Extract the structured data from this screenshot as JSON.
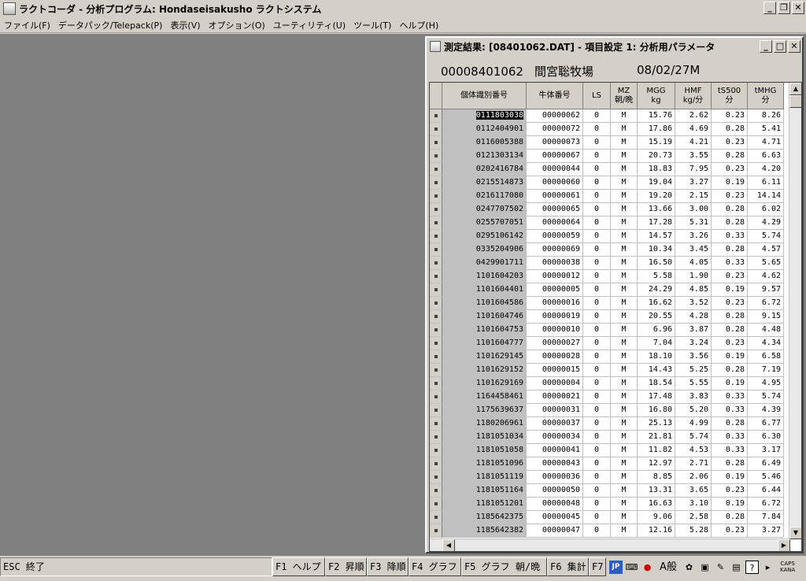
{
  "window": {
    "title": "ラクトコーダ - 分析プログラム: Hondaseisakusho ラクトシステム",
    "min": "_",
    "max": "❐",
    "close": "✕"
  },
  "menu": [
    "ファイル(F)",
    "データパック/Telepack(P)",
    "表示(V)",
    "オプション(O)",
    "ユーティリティ(U)",
    "ツール(T)",
    "ヘルプ(H)"
  ],
  "child": {
    "title": "測定結果: [08401062.DAT] - 項目設定 1: 分析用パラメータ",
    "min": "_",
    "max": "□",
    "close": "✕",
    "farm_code": "00008401062",
    "farm_name": "間宮聡牧場",
    "date": "08/02/27M"
  },
  "columns": [
    {
      "l1": "個体識別番号",
      "l2": ""
    },
    {
      "l1": "牛体番号",
      "l2": ""
    },
    {
      "l1": "LS",
      "l2": ""
    },
    {
      "l1": "MZ",
      "l2": "朝/晩"
    },
    {
      "l1": "MGG",
      "l2": "kg"
    },
    {
      "l1": "HMF",
      "l2": "kg/分"
    },
    {
      "l1": "tS500",
      "l2": "分"
    },
    {
      "l1": "tMHG",
      "l2": "分"
    }
  ],
  "rows": [
    [
      "0111803038",
      "00000062",
      "0",
      "M",
      "15.76",
      "2.62",
      "0.23",
      "8.26"
    ],
    [
      "0112404901",
      "00000072",
      "0",
      "M",
      "17.86",
      "4.69",
      "0.28",
      "5.41"
    ],
    [
      "0116005388",
      "00000073",
      "0",
      "M",
      "15.19",
      "4.21",
      "0.23",
      "4.71"
    ],
    [
      "0121303134",
      "00000067",
      "0",
      "M",
      "20.73",
      "3.55",
      "0.28",
      "6.63"
    ],
    [
      "0202416784",
      "00000044",
      "0",
      "M",
      "18.83",
      "7.95",
      "0.23",
      "4.20"
    ],
    [
      "0215514873",
      "00000060",
      "0",
      "M",
      "19.04",
      "3.27",
      "0.19",
      "6.11"
    ],
    [
      "0216117080",
      "00000061",
      "0",
      "M",
      "19.20",
      "2.15",
      "0.23",
      "14.14"
    ],
    [
      "0247707502",
      "00000065",
      "0",
      "M",
      "13.66",
      "3.00",
      "0.28",
      "6.02"
    ],
    [
      "0255707051",
      "00000064",
      "0",
      "M",
      "17.28",
      "5.31",
      "0.28",
      "4.29"
    ],
    [
      "0295106142",
      "00000059",
      "0",
      "M",
      "14.57",
      "3.26",
      "0.33",
      "5.74"
    ],
    [
      "0335204906",
      "00000069",
      "0",
      "M",
      "10.34",
      "3.45",
      "0.28",
      "4.57"
    ],
    [
      "0429901711",
      "00000038",
      "0",
      "M",
      "16.50",
      "4.05",
      "0.33",
      "5.65"
    ],
    [
      "1101604203",
      "00000012",
      "0",
      "M",
      "5.58",
      "1.90",
      "0.23",
      "4.62"
    ],
    [
      "1101604401",
      "00000005",
      "0",
      "M",
      "24.29",
      "4.85",
      "0.19",
      "9.57"
    ],
    [
      "1101604586",
      "00000016",
      "0",
      "M",
      "16.62",
      "3.52",
      "0.23",
      "6.72"
    ],
    [
      "1101604746",
      "00000019",
      "0",
      "M",
      "20.55",
      "4.28",
      "0.28",
      "9.15"
    ],
    [
      "1101604753",
      "00000010",
      "0",
      "M",
      "6.96",
      "3.87",
      "0.28",
      "4.48"
    ],
    [
      "1101604777",
      "00000027",
      "0",
      "M",
      "7.04",
      "3.24",
      "0.23",
      "4.34"
    ],
    [
      "1101629145",
      "00000028",
      "0",
      "M",
      "18.10",
      "3.56",
      "0.19",
      "6.58"
    ],
    [
      "1101629152",
      "00000015",
      "0",
      "M",
      "14.43",
      "5.25",
      "0.28",
      "7.19"
    ],
    [
      "1101629169",
      "00000004",
      "0",
      "M",
      "18.54",
      "5.55",
      "0.19",
      "4.95"
    ],
    [
      "1164458461",
      "00000021",
      "0",
      "M",
      "17.48",
      "3.83",
      "0.33",
      "5.74"
    ],
    [
      "1175639637",
      "00000031",
      "0",
      "M",
      "16.80",
      "5.20",
      "0.33",
      "4.39"
    ],
    [
      "1180206961",
      "00000037",
      "0",
      "M",
      "25.13",
      "4.99",
      "0.28",
      "6.77"
    ],
    [
      "1181051034",
      "00000034",
      "0",
      "M",
      "21.81",
      "5.74",
      "0.33",
      "6.30"
    ],
    [
      "1181051058",
      "00000041",
      "0",
      "M",
      "11.82",
      "4.53",
      "0.33",
      "3.17"
    ],
    [
      "1181051096",
      "00000043",
      "0",
      "M",
      "12.97",
      "2.71",
      "0.28",
      "6.49"
    ],
    [
      "1181051119",
      "00000036",
      "0",
      "M",
      "8.85",
      "2.06",
      "0.19",
      "5.46"
    ],
    [
      "1181051164",
      "00000050",
      "0",
      "M",
      "13.31",
      "3.65",
      "0.23",
      "6.44"
    ],
    [
      "1181051201",
      "00000048",
      "0",
      "M",
      "16.63",
      "3.10",
      "0.19",
      "6.72"
    ],
    [
      "1185642375",
      "00000045",
      "0",
      "M",
      "9.06",
      "2.58",
      "0.28",
      "7.84"
    ],
    [
      "1185642382",
      "00000047",
      "0",
      "M",
      "12.16",
      "5.28",
      "0.23",
      "3.27"
    ]
  ],
  "fnbar": {
    "esc": "ESC 終了",
    "keys": [
      "F1 ヘルプ",
      "F2 昇順",
      "F3 降順",
      "F4 グラフ",
      "F5 グラフ 朝/晩",
      "F6 集計",
      "F7"
    ]
  },
  "tray": {
    "ime": "JP",
    "mode": "A般",
    "caps": "CAPS",
    "kana": "KANA"
  }
}
